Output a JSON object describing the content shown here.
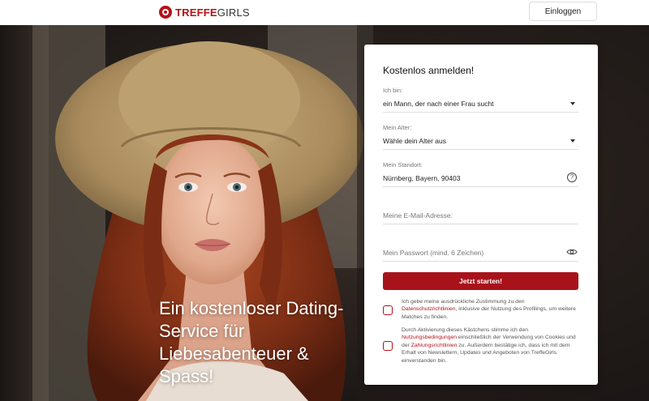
{
  "brand": {
    "name_bold": "TREFFE",
    "name_light": "GIRLS"
  },
  "header": {
    "login_label": "Einloggen"
  },
  "hero": {
    "tagline": "Ein kostenloser Dating-Service für Liebesabenteuer & Spass!"
  },
  "form": {
    "title": "Kostenlos anmelden!",
    "fields": {
      "gender": {
        "label": "Ich bin:",
        "value": "ein Mann, der nach einer Frau sucht"
      },
      "age": {
        "label": "Mein Alter:",
        "value": "Wähle dein Alter aus"
      },
      "location": {
        "label": "Mein Standort:",
        "value": "Nürnberg, Bayern, 90403"
      },
      "email": {
        "placeholder": "Meine E-Mail-Adresse:"
      },
      "password": {
        "placeholder": "Mein Passwort (mind. 6 Zeichen)"
      }
    },
    "submit_label": "Jetzt starten!",
    "consent1": {
      "before": "Ich gebe meine ausdrückliche Zustimmung zu den ",
      "link": "Datenschutzrichtlinien",
      "after": ", inklusive der Nutzung des Profilings, um weitere Matches zu finden."
    },
    "consent2": {
      "before": "Durch Aktivierung dieses Kästchens stimme ich den ",
      "link1": "Nutzungsbedingungen",
      "middle": " einschließlich der Verwendung von Cookies und der ",
      "link2": "Zahlungsrichtlinien",
      "after": " zu. Außerdem bestätige ich, dass ich mit dem Erhalt von Newslettern, Updates und Angeboten von TreffeGirls einverstanden bin."
    }
  },
  "icons": {
    "help": "?"
  },
  "colors": {
    "brand_red": "#b3121b",
    "button_red": "#a8131b"
  }
}
